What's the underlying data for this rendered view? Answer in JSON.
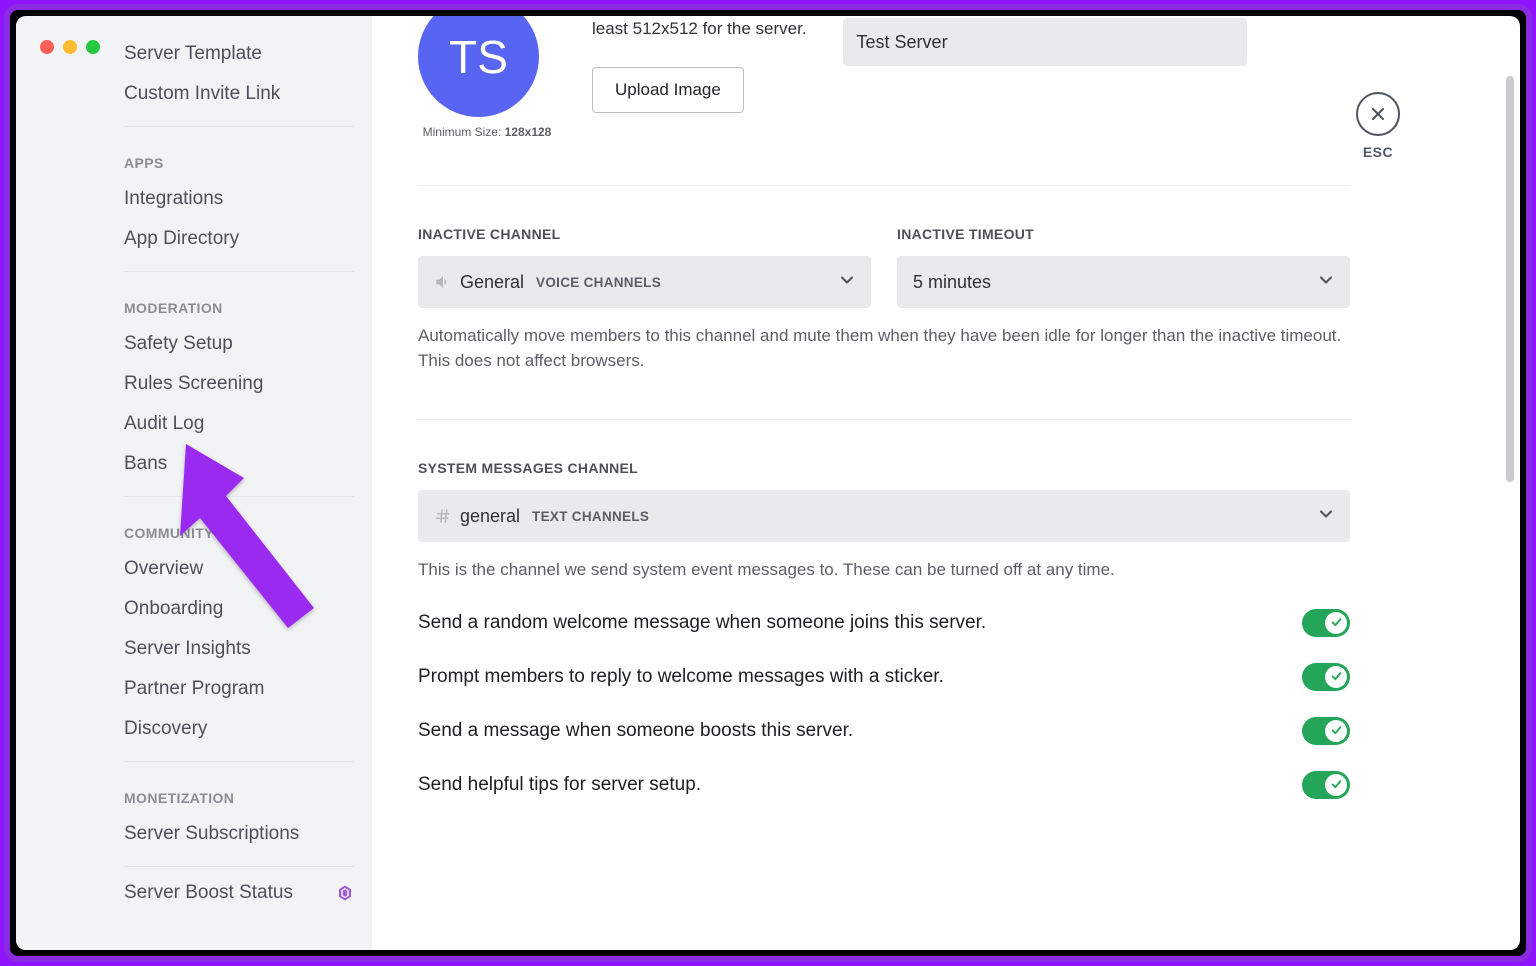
{
  "sidebar": {
    "items_top": [
      "Server Template",
      "Custom Invite Link"
    ],
    "sections": [
      {
        "header": "APPS",
        "items": [
          "Integrations",
          "App Directory"
        ]
      },
      {
        "header": "MODERATION",
        "items": [
          "Safety Setup",
          "Rules Screening",
          "Audit Log",
          "Bans"
        ]
      },
      {
        "header": "COMMUNITY",
        "items": [
          "Overview",
          "Onboarding",
          "Server Insights",
          "Partner Program",
          "Discovery"
        ]
      },
      {
        "header": "MONETIZATION",
        "items": [
          "Server Subscriptions"
        ]
      }
    ],
    "boost": "Server Boost Status"
  },
  "close": {
    "esc": "ESC"
  },
  "overview": {
    "avatar_initials": "TS",
    "min_size_prefix": "Minimum Size: ",
    "min_size_value": "128x128",
    "rec_text": "least 512x512 for the server.",
    "upload_btn": "Upload Image",
    "server_name": "Test Server"
  },
  "inactive": {
    "channel_head": "INACTIVE CHANNEL",
    "timeout_head": "INACTIVE TIMEOUT",
    "channel_name": "General",
    "channel_tag": "VOICE CHANNELS",
    "timeout_value": "5 minutes",
    "help": "Automatically move members to this channel and mute them when they have been idle for longer than the inactive timeout. This does not affect browsers."
  },
  "system": {
    "head": "SYSTEM MESSAGES CHANNEL",
    "channel_name": "general",
    "channel_tag": "TEXT CHANNELS",
    "help": "This is the channel we send system event messages to. These can be turned off at any time.",
    "toggles": [
      "Send a random welcome message when someone joins this server.",
      "Prompt members to reply to welcome messages with a sticker.",
      "Send a message when someone boosts this server.",
      "Send helpful tips for server setup."
    ]
  }
}
